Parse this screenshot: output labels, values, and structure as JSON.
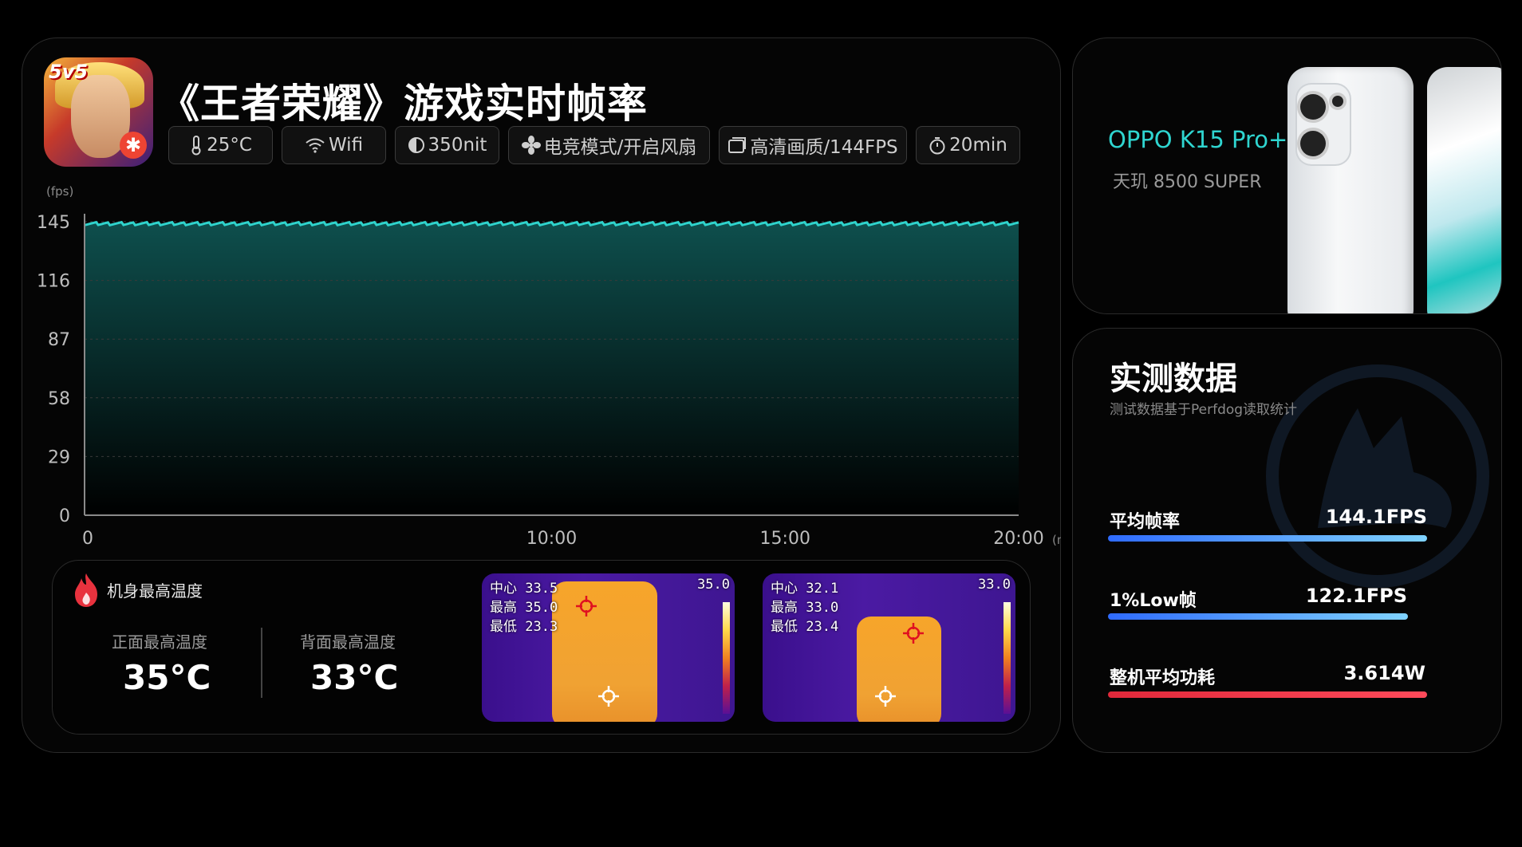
{
  "title": "《王者荣耀》游戏实时帧率",
  "chips": [
    {
      "icon": "thermometer-icon",
      "label": "25°C"
    },
    {
      "icon": "wifi-icon",
      "label": "Wifi"
    },
    {
      "icon": "brightness-icon",
      "label": "350nit"
    },
    {
      "icon": "fan-icon",
      "label": "电竞模式/开启风扇"
    },
    {
      "icon": "image-quality-icon",
      "label": "高清画质/144FPS"
    },
    {
      "icon": "timer-icon",
      "label": "20min"
    }
  ],
  "game_icon": {
    "tag": "5v5"
  },
  "chart_data": {
    "type": "area",
    "ylabel": "(fps)",
    "xunit": "(min)",
    "yticks": [
      0,
      29,
      58,
      87,
      116,
      145
    ],
    "ylim": [
      0,
      145
    ],
    "xticks": [
      "0",
      "10:00",
      "15:00",
      "20:00"
    ],
    "xtick_values": [
      0,
      10,
      15,
      20
    ],
    "xlim": [
      0,
      20
    ],
    "series": [
      {
        "values_note_avg": 144.1,
        "value": 144.1
      }
    ],
    "grid": true,
    "colors": {
      "line": "#2fd3cc",
      "fill_top": "#0e4f4d",
      "fill_bottom": "#000000"
    }
  },
  "temperature": {
    "title": "机身最高温度",
    "front_label": "正面最高温度",
    "front_value": "35°C",
    "back_label": "背面最高温度",
    "back_value": "33°C",
    "front_thermal": {
      "center": "中心 33.5",
      "max": "最高 35.0",
      "min": "最低 23.3",
      "scale_top": "35.0"
    },
    "back_thermal": {
      "center": "中心 32.1",
      "max": "最高 33.0",
      "min": "最低 23.4",
      "scale_top": "33.0"
    }
  },
  "device": {
    "brand": "OPPO K15 Pro+",
    "chip": "天玑 8500 SUPER"
  },
  "stats": {
    "title": "实测数据",
    "subtitle": "测试数据基于Perfdog读取统计",
    "items": [
      {
        "label": "平均帧率",
        "value": "144.1FPS",
        "fill": 1.0,
        "color_from": "#2f6bff",
        "color_to": "#7fd3ff"
      },
      {
        "label": "1%Low帧",
        "value": "122.1FPS",
        "fill": 0.94,
        "color_from": "#2f6bff",
        "color_to": "#7fd3ff"
      },
      {
        "label": "整机平均功耗",
        "value": "3.614W",
        "fill": 1.0,
        "color_from": "#e0283a",
        "color_to": "#ff4a5a"
      }
    ]
  }
}
